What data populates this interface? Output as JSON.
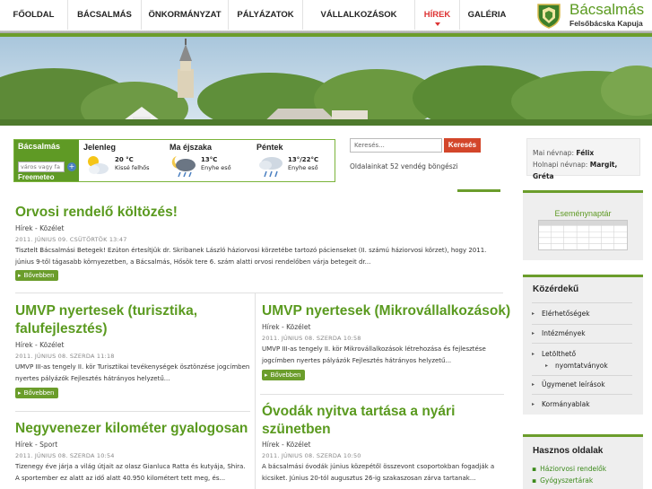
{
  "nav": {
    "items": [
      "FŐOLDAL",
      "BÁCSALMÁS",
      "ÖNKORMÁNYZAT",
      "PÁLYÁZATOK",
      "VÁLLALKOZÁSOK",
      "HÍREK",
      "GALÉRIA"
    ],
    "active": "HÍREK"
  },
  "site": {
    "title": "Bácsalmás",
    "subtitle": "Felsőbácska Kapuja"
  },
  "weather": {
    "location": "Bácsalmás",
    "input_placeholder": "város vagy fa",
    "brand": "Freemeteo",
    "columns": [
      {
        "title": "Jelenleg",
        "temp": "20 °C",
        "desc": "Kissé felhős",
        "icon": "partly-cloudy-icon"
      },
      {
        "title": "Ma éjszaka",
        "temp": "13°C",
        "desc": "Enyhe eső",
        "icon": "night-rain-icon"
      },
      {
        "title": "Péntek",
        "temp": "13°/22°C",
        "desc": "Enyhe eső",
        "icon": "rain-icon"
      }
    ]
  },
  "search": {
    "placeholder": "Keresés...",
    "button": "Keresés",
    "visitors": "Oldalainkat 52 vendég böngészi"
  },
  "nameday": {
    "today_label": "Mai névnap:",
    "today": "Félix",
    "tomorrow_label": "Holnapi névnap:",
    "tomorrow": "Margit, Gréta"
  },
  "calendar": {
    "title": "Eseménynaptár"
  },
  "kozerdeku": {
    "title": "Közérdekű",
    "links": [
      "Elérhetőségek",
      "Intézmények",
      "Letölthető",
      "nyomtatványok",
      "Ügymenet leírások",
      "Kormányablak"
    ]
  },
  "hasznos": {
    "title": "Hasznos oldalak",
    "links": [
      "Háziorvosi rendelők",
      "Gyógyszertárak"
    ]
  },
  "articles": [
    {
      "title": "Orvosi rendelő költözés!",
      "category": "Hírek - Közélet",
      "date": "2011. JÚNIUS 09. CSÜTÖRTÖK 13:47",
      "text": "Tisztelt Bácsalmási Betegek! Ezúton értesítjük dr. Skribanek László háziorvosi körzetébe tartozó pácienseket (II. számú háziorvosi körzet), hogy 2011. június 9-től tágasabb környezetben, a Bácsalmás, Hősök tere 6. szám alatti orvosi rendelőben várja betegeit dr...",
      "more": "Bővebben"
    },
    {
      "title": "UMVP nyertesek (turisztika, falufejlesztés)",
      "category": "Hírek - Közélet",
      "date": "2011. JÚNIUS 08. SZERDA 11:18",
      "text": "UMVP III-as tengely II. kör Turisztikai tevékenységek ösztönzése jogcímben nyertes pályázók Fejlesztés hátrányos helyzetű...",
      "more": "Bővebben"
    },
    {
      "title": "UMVP nyertesek (Mikrovállalkozások)",
      "category": "Hírek - Közélet",
      "date": "2011. JÚNIUS 08. SZERDA 10:58",
      "text": "UMVP III-as tengely II. kör Mikrovállalkozások létrehozása és fejlesztése jogcímben nyertes pályázók Fejlesztés hátrányos helyzetű...",
      "more": "Bővebben"
    },
    {
      "title": "Negyvenezer kilométer gyalogosan",
      "category": "Hírek - Sport",
      "date": "2011. JÚNIUS 08. SZERDA 10:54",
      "text": "Tizenegy éve járja a világ útjait az olasz Gianluca Ratta és kutyája, Shira. A sportember ez alatt az idő alatt 40.950 kilométert tett meg, és..."
    },
    {
      "title": "Óvodák nyitva tartása a nyári szünetben",
      "category": "Hírek - Közélet",
      "date": "2011. JÚNIUS 08. SZERDA 10:50",
      "text": "A bácsalmási óvodák június közepétől összevont csoportokban fogadják a kicsiket. Június 20-tól augusztus 26-ig szakaszosan zárva tartanak..."
    }
  ],
  "colors": {
    "accent_green": "#6b9d2b",
    "title_green": "#5a9a1f",
    "search_red": "#d3462a",
    "active_nav": "#d33"
  }
}
